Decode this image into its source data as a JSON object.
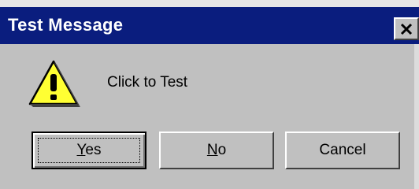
{
  "dialog": {
    "title": "Test Message",
    "message": "Click to Test",
    "icons": {
      "close": "close-icon",
      "warning": "warning-icon"
    },
    "buttons": {
      "yes": {
        "label_prefix": "",
        "label_underlined": "Y",
        "label_rest": "es"
      },
      "no": {
        "label_prefix": "",
        "label_underlined": "N",
        "label_rest": "o"
      },
      "cancel": {
        "label": "Cancel"
      }
    },
    "colors": {
      "titlebar": "#0a1d7e",
      "face": "#c0c0c0",
      "warning_fill": "#ffff33"
    }
  }
}
